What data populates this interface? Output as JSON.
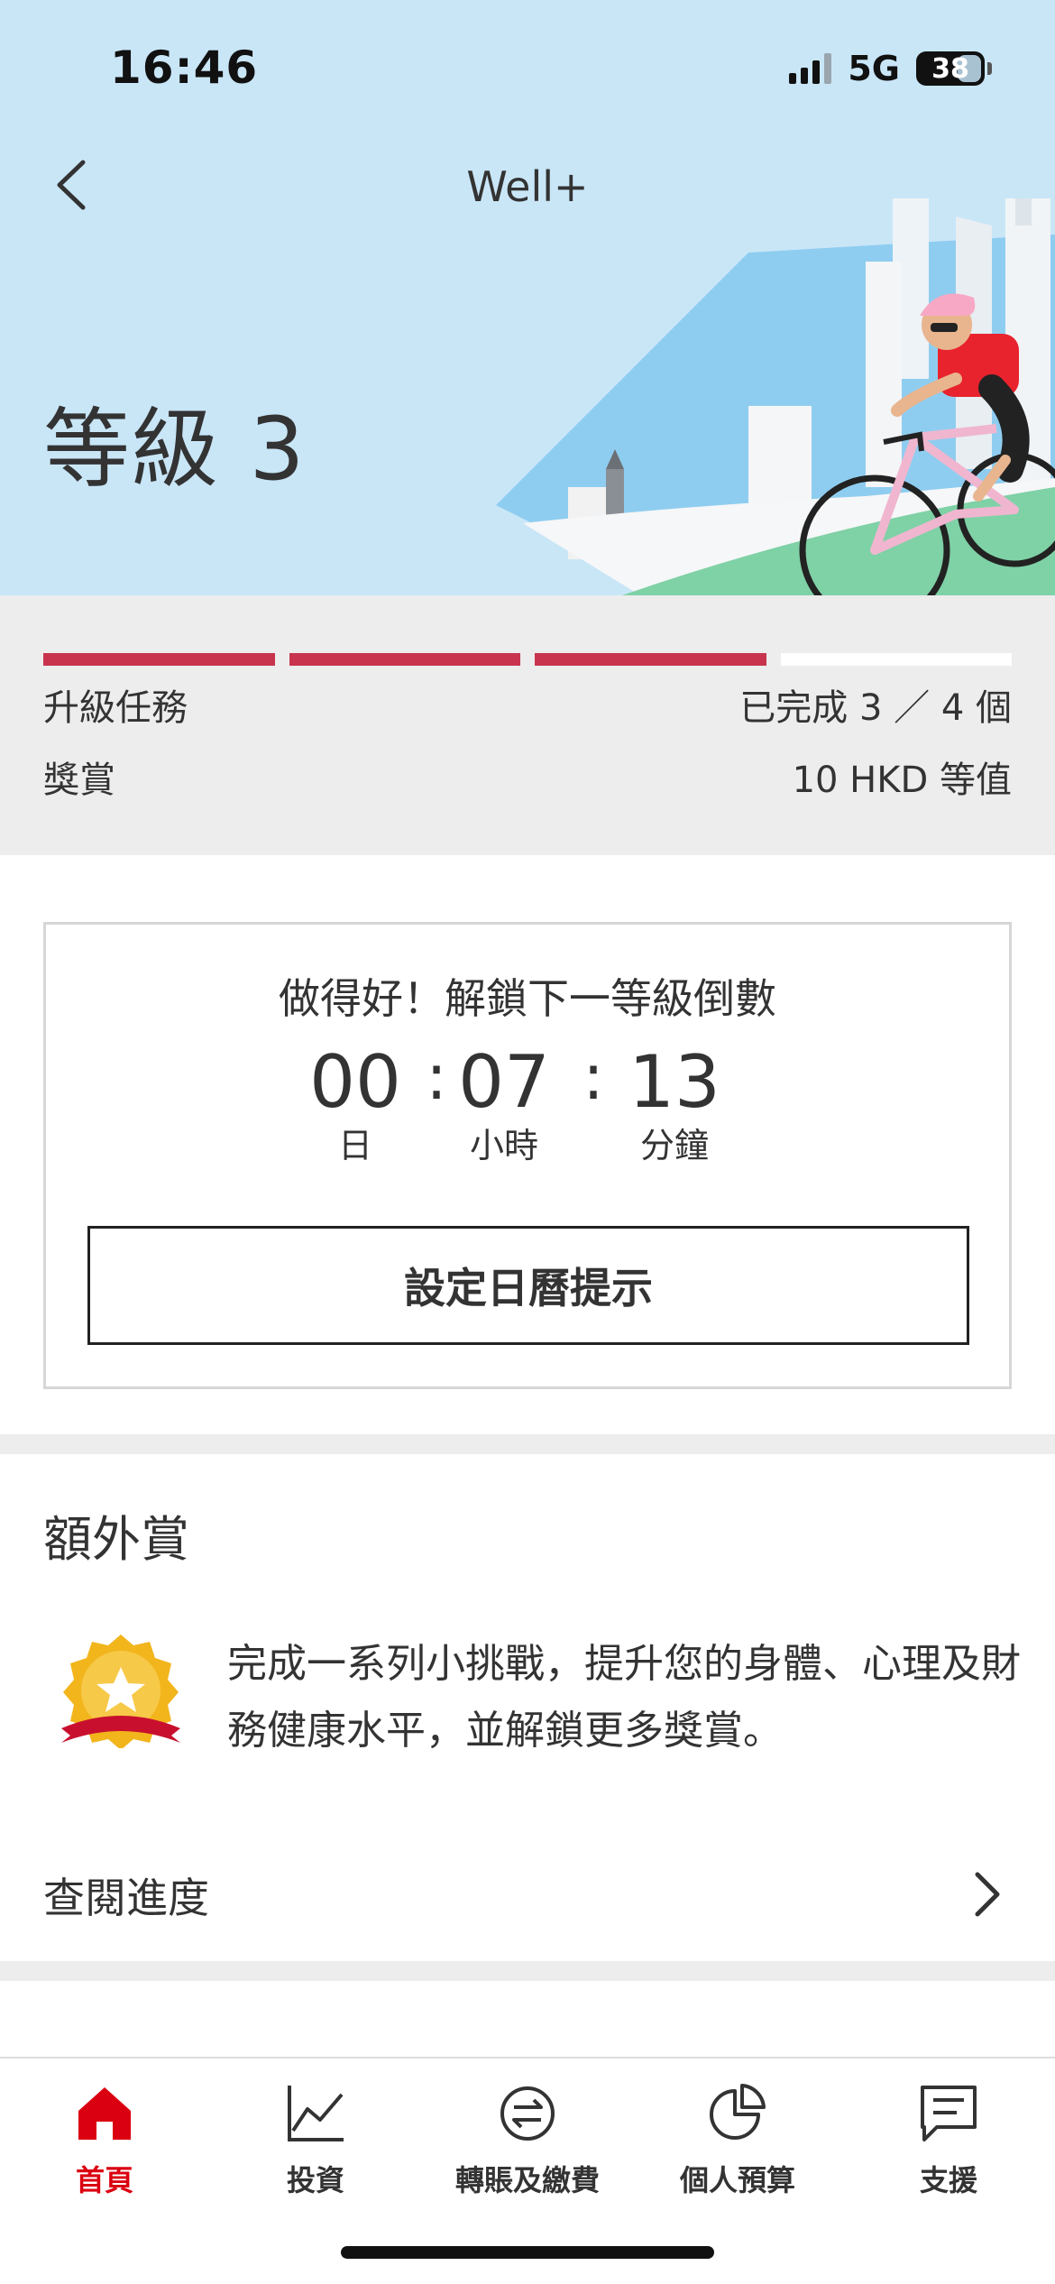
{
  "status_bar": {
    "time": "16:46",
    "network": "5G",
    "battery": "38",
    "battery_level_percent": 38
  },
  "nav": {
    "title": "Well+",
    "back_icon": "chevron-left-icon"
  },
  "hero": {
    "level_title": "等級 3"
  },
  "progress": {
    "segments_total": 4,
    "segments_completed": 3,
    "completed_color": "#c8344e",
    "remaining_color": "#ffffff",
    "tasks_label": "升級任務",
    "tasks_value": "已完成 3 ／ 4 個",
    "reward_label": "獎賞",
    "reward_value": "10 HKD 等值"
  },
  "countdown": {
    "heading": "做得好！解鎖下一等級倒數",
    "days": "00",
    "hours": "07",
    "minutes": "13",
    "separator": ":",
    "days_unit": "日",
    "hours_unit": "小時",
    "minutes_unit": "分鐘",
    "calendar_button": "設定日曆提示"
  },
  "bonus": {
    "title": "額外賞",
    "icon": "star-medal-icon",
    "description": "完成一系列小挑戰，提升您的身體、心理及財務健康水平，並解鎖更多獎賞。",
    "progress_link": "查閱進度"
  },
  "tabbar": {
    "accent_color": "#db0011",
    "tabs": [
      {
        "label": "首頁",
        "icon": "home-icon",
        "active": true
      },
      {
        "label": "投資",
        "icon": "chart-line-icon",
        "active": false
      },
      {
        "label": "轉賬及繳費",
        "icon": "transfer-icon",
        "active": false
      },
      {
        "label": "個人預算",
        "icon": "pie-chart-icon",
        "active": false
      },
      {
        "label": "支援",
        "icon": "chat-icon",
        "active": false
      }
    ]
  }
}
